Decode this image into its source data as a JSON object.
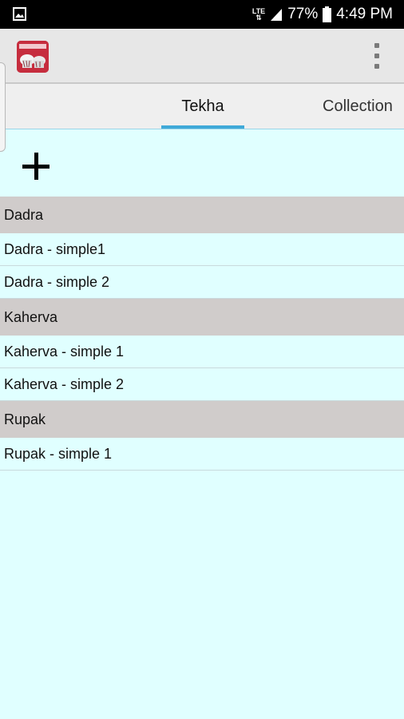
{
  "status_bar": {
    "network": "LTE",
    "battery": "77%",
    "time": "4:49 PM"
  },
  "tabs": [
    {
      "label": "Tekha",
      "selected": true
    },
    {
      "label": "Collection",
      "selected": false
    }
  ],
  "list": {
    "groups": [
      {
        "title": "Dadra",
        "items": [
          "Dadra - simple1",
          "Dadra - simple 2"
        ]
      },
      {
        "title": "Kaherva",
        "items": [
          "Kaherva - simple 1",
          "Kaherva - simple 2"
        ]
      },
      {
        "title": "Rupak",
        "items": [
          "Rupak - simple 1"
        ]
      }
    ]
  },
  "colors": {
    "background": "#e0ffff",
    "group_header": "#d0cccb",
    "tab_indicator": "#3fa9d8"
  }
}
